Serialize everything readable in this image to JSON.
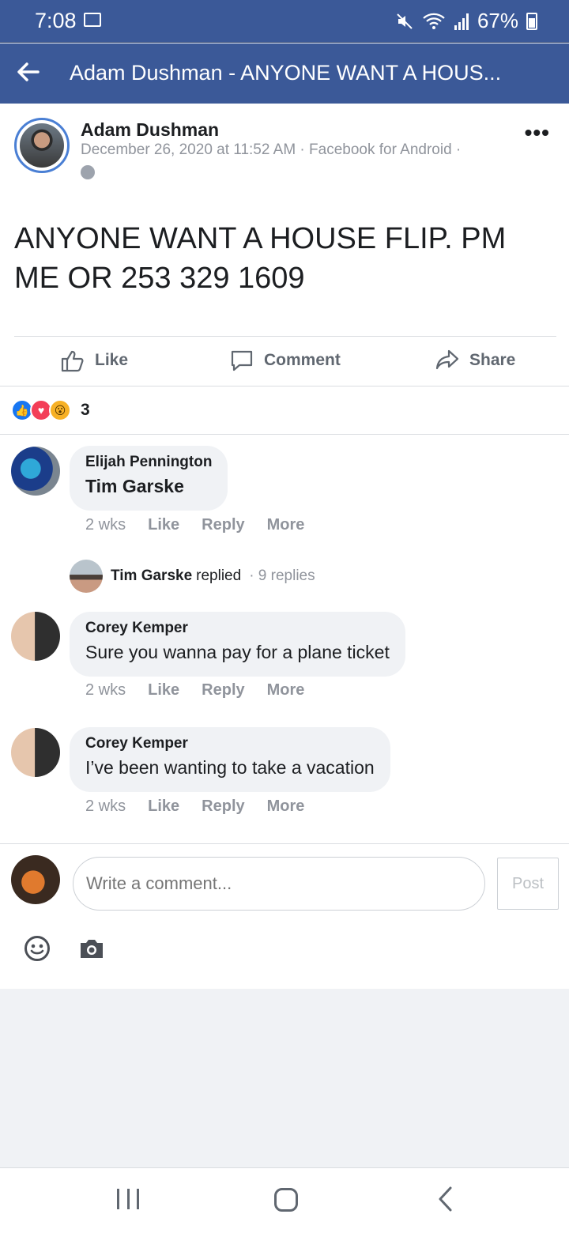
{
  "status_bar": {
    "time": "7:08",
    "battery": "67%"
  },
  "app_bar": {
    "title": "Adam Dushman - ANYONE WANT A HOUS..."
  },
  "post": {
    "author": "Adam Dushman",
    "meta": "December 26, 2020 at 11:52 AM · Facebook for Android ·",
    "text": "ANYONE WANT A HOUSE FLIP. PM ME OR 253 329 1609",
    "actions": {
      "like": "Like",
      "comment": "Comment",
      "share": "Share"
    },
    "reaction_count": "3"
  },
  "comments": [
    {
      "author": "Elijah Pennington",
      "text": "Tim Garske",
      "time": "2 wks",
      "like": "Like",
      "reply": "Reply",
      "more": "More"
    },
    {
      "author": "Corey Kemper",
      "text": "Sure you wanna pay for a plane ticket",
      "time": "2 wks",
      "like": "Like",
      "reply": "Reply",
      "more": "More"
    },
    {
      "author": "Corey Kemper",
      "text": "I’ve been wanting to take a vacation",
      "time": "2 wks",
      "like": "Like",
      "reply": "Reply",
      "more": "More"
    }
  ],
  "reply_summary": {
    "name": "Tim Garske",
    "verb": "replied",
    "count": "· 9 replies"
  },
  "composer": {
    "placeholder": "Write a comment...",
    "post_label": "Post"
  },
  "colors": {
    "brand": "#3b5998",
    "muted": "#90949c"
  }
}
